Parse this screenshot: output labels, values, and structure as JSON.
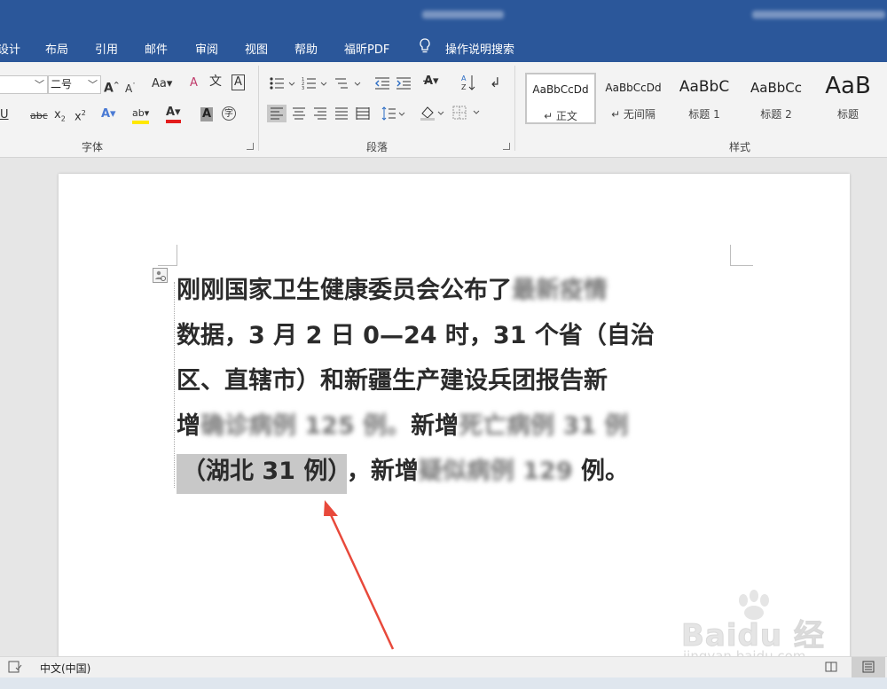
{
  "ribbon_tabs": [
    "设计",
    "布局",
    "引用",
    "邮件",
    "审阅",
    "视图",
    "帮助",
    "福昕PDF"
  ],
  "tell_me": "操作说明搜索",
  "font_group": {
    "label": "字体",
    "font_size": "二号",
    "change_case": "Aa"
  },
  "paragraph_group": {
    "label": "段落"
  },
  "styles_group": {
    "label": "样式",
    "items": [
      {
        "preview": "AaBbCcDd",
        "name": "↵ 正文"
      },
      {
        "preview": "AaBbCcDd",
        "name": "↵ 无间隔"
      },
      {
        "preview": "AaBbC",
        "name": "标题 1"
      },
      {
        "preview": "AaBbCc",
        "name": "标题 2"
      },
      {
        "preview": "AaB",
        "name": "标题"
      }
    ]
  },
  "document": {
    "lines": [
      [
        "刚刚国家卫生健康委员会公布了",
        "最新疫情"
      ],
      [
        "数据，3 月 2 日 0—24 时，31 个省（自治"
      ],
      [
        "区、直辖市）和新疆生产建设兵团报告新"
      ],
      [
        "增",
        "确诊病例 125 例。",
        "新增",
        "死亡病例 31 例"
      ],
      [
        "（湖北 31 例）",
        "，新增",
        "疑似病例 129",
        " 例。"
      ]
    ]
  },
  "status_bar": {
    "language": "中文(中国)"
  },
  "watermark": {
    "brand": "Baidu 经验",
    "url": "jingyan.baidu.com"
  },
  "colors": {
    "title_bar": "#2b579a",
    "ribbon_bg": "#f3f3f3",
    "annotation_arrow": "#e8493b",
    "highlight": "#c8c8c8"
  }
}
